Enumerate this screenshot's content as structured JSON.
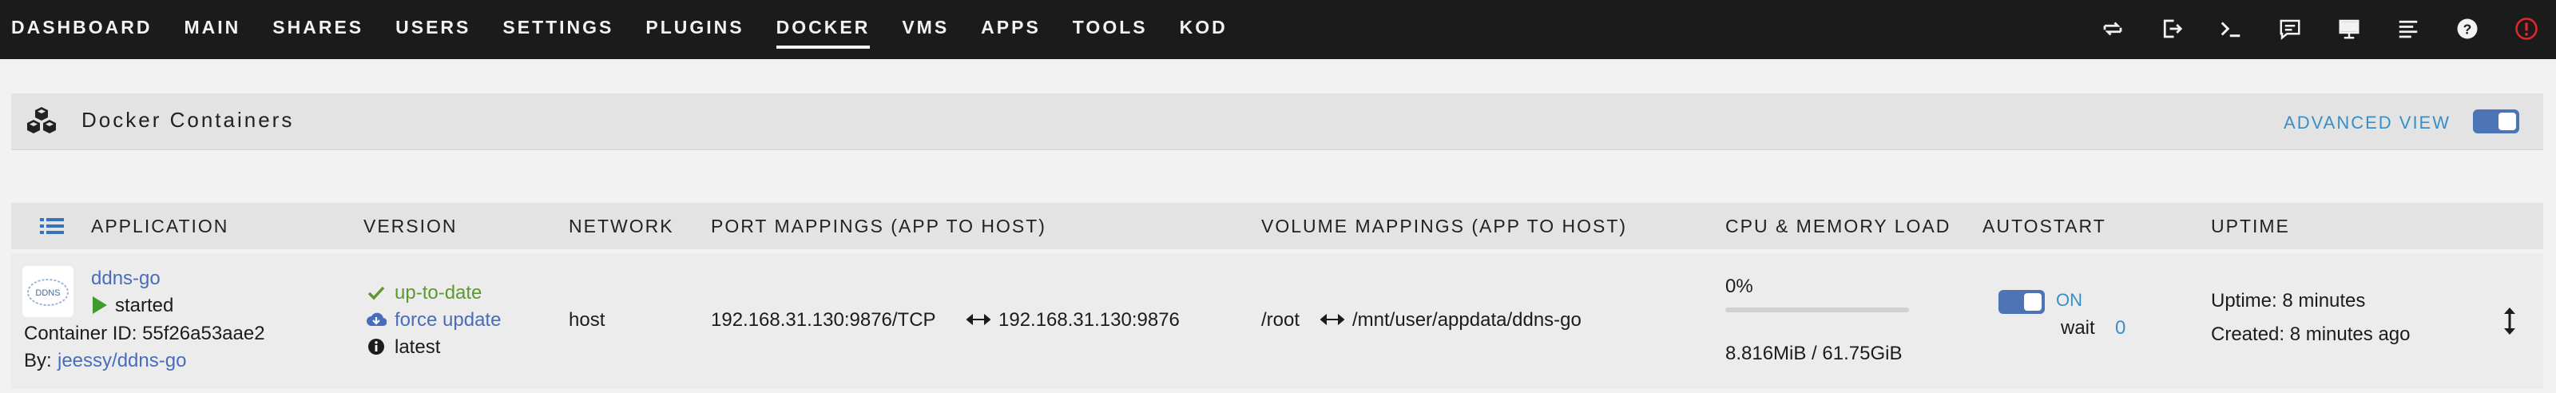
{
  "nav": {
    "items": [
      {
        "label": "DASHBOARD",
        "active": false
      },
      {
        "label": "MAIN",
        "active": false
      },
      {
        "label": "SHARES",
        "active": false
      },
      {
        "label": "USERS",
        "active": false
      },
      {
        "label": "SETTINGS",
        "active": false
      },
      {
        "label": "PLUGINS",
        "active": false
      },
      {
        "label": "DOCKER",
        "active": true
      },
      {
        "label": "VMS",
        "active": false
      },
      {
        "label": "APPS",
        "active": false
      },
      {
        "label": "TOOLS",
        "active": false
      },
      {
        "label": "KOD",
        "active": false
      }
    ],
    "icons": [
      "refresh-icon",
      "logout-icon",
      "terminal-icon",
      "feedback-icon",
      "monitor-icon",
      "log-icon",
      "help-icon",
      "alert-icon"
    ]
  },
  "section": {
    "title": "Docker Containers",
    "advanced_view_label": "ADVANCED VIEW",
    "advanced_view_on": true
  },
  "table": {
    "headers": {
      "application": "APPLICATION",
      "version": "VERSION",
      "network": "NETWORK",
      "ports": "PORT MAPPINGS (APP TO HOST)",
      "volumes": "VOLUME MAPPINGS (APP TO HOST)",
      "load": "CPU & MEMORY LOAD",
      "autostart": "AUTOSTART",
      "uptime": "UPTIME"
    },
    "rows": [
      {
        "name": "ddns-go",
        "logo_text": "DDNS",
        "state": "started",
        "container_id": "Container ID: 55f26a53aae2",
        "by_label": "By:",
        "by_link": "jeessy/ddns-go",
        "version_status": "up-to-date",
        "force_update": "force update",
        "tag": "latest",
        "network": "host",
        "port_app": "192.168.31.130:9876/TCP",
        "port_host": "192.168.31.130:9876",
        "volume_app": "/root",
        "volume_host": "/mnt/user/appdata/ddns-go",
        "cpu": "0%",
        "cpu_fraction": 0,
        "memory": "8.816MiB / 61.75GiB",
        "autostart_label": "ON",
        "autostart_on": true,
        "wait_label": "wait",
        "wait_value": "0",
        "uptime": "Uptime: 8 minutes",
        "created": "Created: 8 minutes ago"
      }
    ]
  },
  "colors": {
    "topbar": "#1c1b1b",
    "accent_blue": "#3a8ec8",
    "toggle_blue": "#4d74b6",
    "link_blue": "#486dba",
    "ok_green": "#5a9a2e",
    "alert_red": "#e22828"
  }
}
